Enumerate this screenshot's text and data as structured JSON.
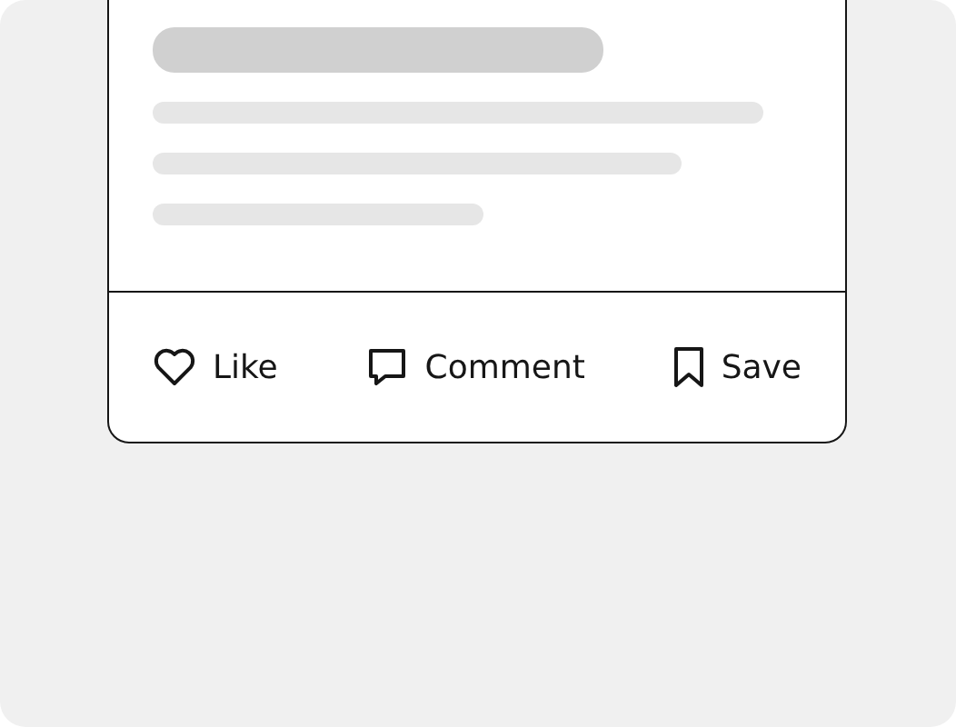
{
  "post_card": {
    "actions": [
      {
        "kind": "like",
        "label": "Like"
      },
      {
        "kind": "comment",
        "label": "Comment"
      },
      {
        "kind": "save",
        "label": "Save"
      }
    ]
  }
}
